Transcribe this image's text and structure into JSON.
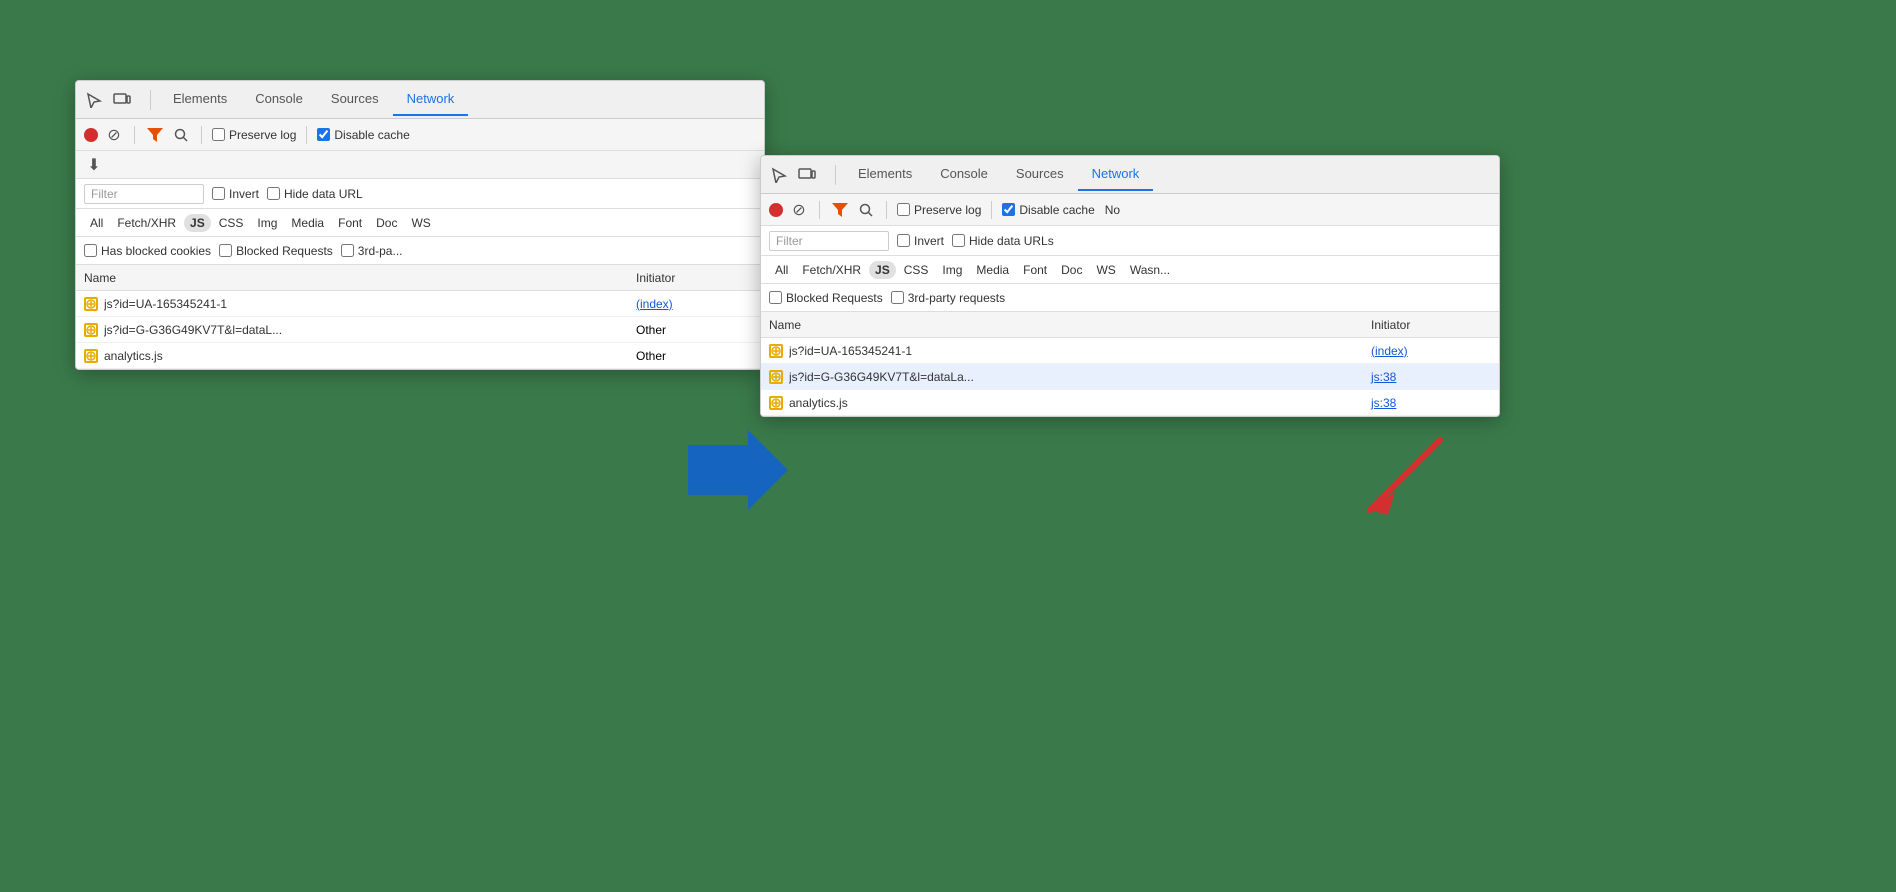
{
  "panel1": {
    "tabs": [
      {
        "label": "Elements",
        "active": false
      },
      {
        "label": "Console",
        "active": false
      },
      {
        "label": "Sources",
        "active": false
      },
      {
        "label": "Network",
        "active": true
      }
    ],
    "toolbar": {
      "record": "●",
      "stop": "🚫",
      "filter": "▼",
      "search": "🔍",
      "preserve_log": "Preserve log",
      "disable_cache": "Disable cache",
      "preserve_checked": false,
      "disable_checked": true
    },
    "filter_placeholder": "Filter",
    "filter_options": {
      "invert": "Invert",
      "hide_data": "Hide data URL"
    },
    "types": [
      "All",
      "Fetch/XHR",
      "JS",
      "CSS",
      "Img",
      "Media",
      "Font",
      "Doc",
      "WS"
    ],
    "active_type": "JS",
    "cookie_options": {
      "has_blocked": "Has blocked cookies",
      "blocked_requests": "Blocked Requests",
      "third_party": "3rd-pa..."
    },
    "columns": {
      "name": "Name",
      "initiator": "Initiator"
    },
    "rows": [
      {
        "icon": "⊕",
        "name": "js?id=UA-165345241-1",
        "initiator": "(index)",
        "initiator_link": true
      },
      {
        "icon": "⊕",
        "name": "js?id=G-G36G49KV7T&l=dataL...",
        "initiator": "Other",
        "initiator_link": false
      },
      {
        "icon": "⊕",
        "name": "analytics.js",
        "initiator": "Other",
        "initiator_link": false
      }
    ]
  },
  "panel2": {
    "tabs": [
      {
        "label": "Elements",
        "active": false
      },
      {
        "label": "Console",
        "active": false
      },
      {
        "label": "Sources",
        "active": false
      },
      {
        "label": "Network",
        "active": true
      }
    ],
    "toolbar": {
      "preserve_log": "Preserve log",
      "disable_cache": "Disable cache",
      "no_label": "No",
      "preserve_checked": false,
      "disable_checked": true
    },
    "filter_placeholder": "Filter",
    "filter_options": {
      "invert": "Invert",
      "hide_data": "Hide data URLs"
    },
    "types": [
      "All",
      "Fetch/XHR",
      "JS",
      "CSS",
      "Img",
      "Media",
      "Font",
      "Doc",
      "WS",
      "Wasn..."
    ],
    "active_type": "JS",
    "cookie_options": {
      "blocked_requests": "Blocked Requests",
      "third_party": "3rd-party requests"
    },
    "columns": {
      "name": "Name",
      "initiator": "Initiator"
    },
    "rows": [
      {
        "icon": "⊕",
        "name": "js?id=UA-165345241-1",
        "initiator": "(index)",
        "initiator_link": true
      },
      {
        "icon": "⊕",
        "name": "js?id=G-G36G49KV7T&l=dataLa...",
        "initiator": "js:38",
        "initiator_link": true
      },
      {
        "icon": "⊕",
        "name": "analytics.js",
        "initiator": "js:38",
        "initiator_link": true
      }
    ]
  },
  "arrow": {
    "blue": "➡",
    "red_label": "↙"
  }
}
